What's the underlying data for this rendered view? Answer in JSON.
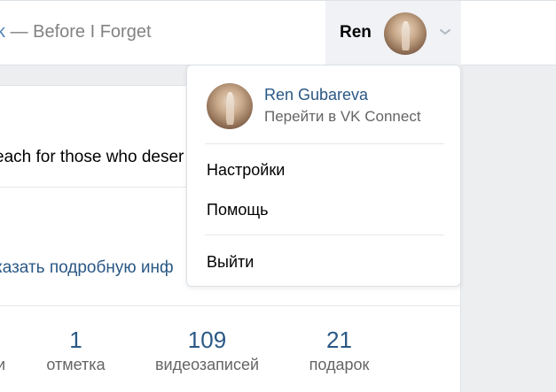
{
  "header": {
    "status_prefix": "k",
    "status_text": "— Before I Forget",
    "user_name": "Ren",
    "chevron_icon": "chevron-down-icon"
  },
  "profile": {
    "status_text": "each for those who deser",
    "details_link": "казать подробную инф",
    "counters": [
      {
        "value": "1",
        "label": "отметка"
      },
      {
        "value": "109",
        "label": "видеозаписей"
      },
      {
        "value": "21",
        "label": "подарок"
      }
    ],
    "partial_label": "и"
  },
  "dropdown": {
    "user_full_name": "Ren Gubareva",
    "connect_link": "Перейти в VK Connect",
    "items": [
      {
        "label": "Настройки"
      },
      {
        "label": "Помощь"
      },
      {
        "label": "Выйти"
      }
    ]
  },
  "colors": {
    "link": "#2a5885",
    "accent": "#5181b8",
    "background": "#edeef0"
  }
}
